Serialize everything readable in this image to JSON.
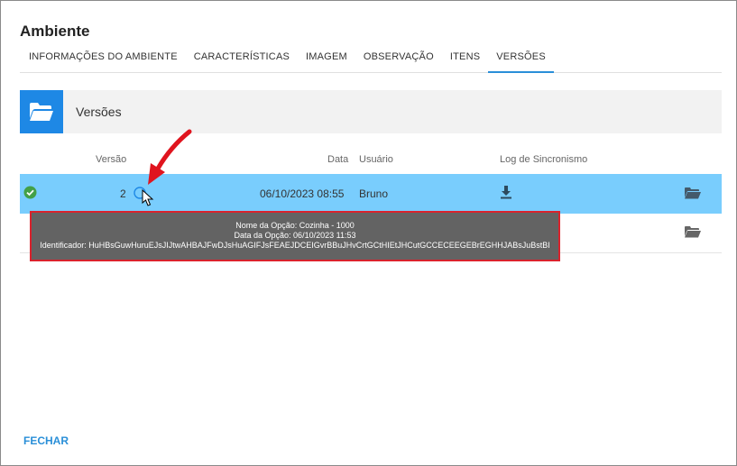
{
  "dialog": {
    "title": "Ambiente"
  },
  "tabs": [
    {
      "label": "INFORMAÇÕES DO AMBIENTE"
    },
    {
      "label": "CARACTERÍSTICAS"
    },
    {
      "label": "IMAGEM"
    },
    {
      "label": "OBSERVAÇÃO"
    },
    {
      "label": "ITENS"
    },
    {
      "label": "VERSÕES",
      "active": true
    }
  ],
  "section": {
    "title": "Versões",
    "icon": "folder-open-icon"
  },
  "table": {
    "headers": {
      "versao": "Versão",
      "data": "Data",
      "usuario": "Usuário",
      "log": "Log de Sincronismo"
    },
    "rows": [
      {
        "status_icon": "check-circle-icon",
        "versao": "2",
        "data": "06/10/2023 08:55",
        "usuario": "Bruno",
        "log_icon": "download-icon",
        "action_icon": "folder-open-icon",
        "selected": true
      },
      {
        "action_icon": "folder-open-icon"
      }
    ]
  },
  "tooltip": {
    "nome": "Nome da Opção: Cozinha - 1000",
    "data": "Data da Opção: 06/10/2023 11:53",
    "identificador": "Identificador: HuHBsGuwHuruEJsJIJtwAHBAJFwDJsHuAGIFJsFEAEJDCEIGvrBBuJHvCrtGCtHIEtJHCutGCCECEEGEBrEGHHJABsJuBstBI"
  },
  "footer": {
    "close_label": "FECHAR"
  },
  "colors": {
    "accent": "#1e88e5",
    "selected_row": "#79cdfd",
    "success": "#43a047",
    "highlight_border": "#d9232d",
    "annotation_arrow": "#e0141e"
  }
}
